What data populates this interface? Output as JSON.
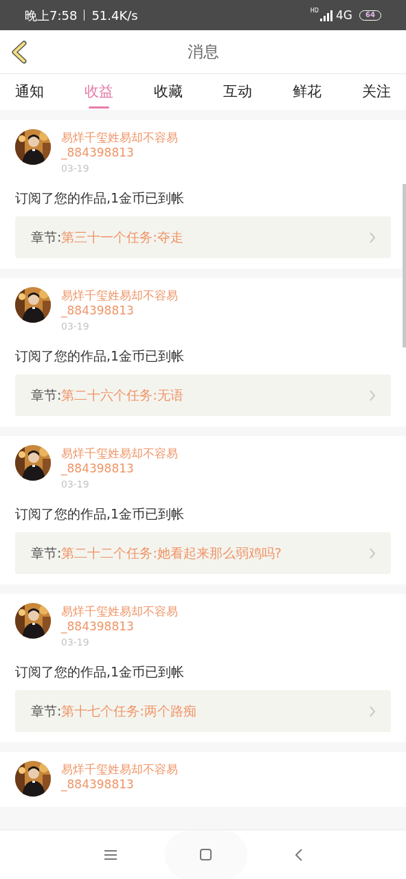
{
  "status_bar": {
    "time": "晚上7:58",
    "speed": "51.4K/s",
    "hd": "HD",
    "network": "4G",
    "battery": "64"
  },
  "header": {
    "title": "消息"
  },
  "tabs": [
    {
      "label": "通知",
      "selected": false
    },
    {
      "label": "收益",
      "selected": true
    },
    {
      "label": "收藏",
      "selected": false
    },
    {
      "label": "互动",
      "selected": false
    },
    {
      "label": "鲜花",
      "selected": false
    },
    {
      "label": "关注",
      "selected": false
    }
  ],
  "messages": [
    {
      "user": "易烊千玺姓易却不容易",
      "user_id": "_884398813",
      "date": "03-19",
      "text": "订阅了您的作品,1金币已到帐",
      "chapter_label": "章节:",
      "chapter": "第三十一个任务:夺走"
    },
    {
      "user": "易烊千玺姓易却不容易",
      "user_id": "_884398813",
      "date": "03-19",
      "text": "订阅了您的作品,1金币已到帐",
      "chapter_label": "章节:",
      "chapter": "第二十六个任务:无语"
    },
    {
      "user": "易烊千玺姓易却不容易",
      "user_id": "_884398813",
      "date": "03-19",
      "text": "订阅了您的作品,1金币已到帐",
      "chapter_label": "章节:",
      "chapter": "第二十二个任务:她看起来那么弱鸡吗?"
    },
    {
      "user": "易烊千玺姓易却不容易",
      "user_id": "_884398813",
      "date": "03-19",
      "text": "订阅了您的作品,1金币已到帐",
      "chapter_label": "章节:",
      "chapter": "第十七个任务:两个路痴"
    },
    {
      "user": "易烊千玺姓易却不容易",
      "user_id": "_884398813"
    }
  ]
}
